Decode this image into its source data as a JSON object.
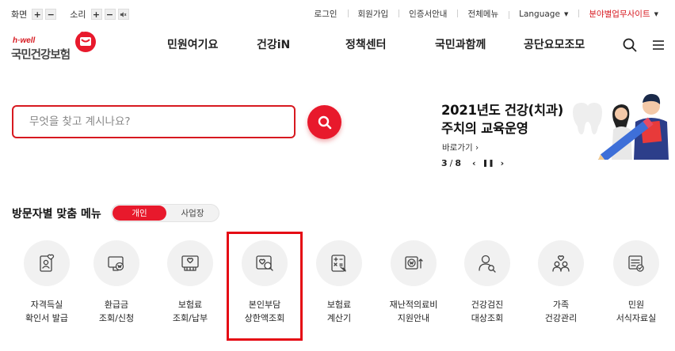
{
  "utility": {
    "screen_label": "화면",
    "sound_label": "소리",
    "plus": "+",
    "minus": "−",
    "links": [
      "로그인",
      "회원가입",
      "인증서안내",
      "전체메뉴",
      "Language",
      "분야별업무사이트"
    ]
  },
  "logo": {
    "tagline": "h·well",
    "name": "국민건강보험"
  },
  "nav": [
    "민원여기요",
    "건강iN",
    "정책센터",
    "국민과함께",
    "공단요모조모"
  ],
  "search": {
    "placeholder": "무엇을 찾고 계시나요?"
  },
  "banner": {
    "title_line1": "2021년도 건강(치과)",
    "title_line2": "주치의 교육운영",
    "more": "바로가기 ›",
    "current": "3",
    "separator": "/",
    "total": "8",
    "prev": "‹",
    "pause": "❚❚",
    "next": "›"
  },
  "visitor_menu": {
    "title": "방문자별 맞춤 메뉴",
    "tabs": [
      "개인",
      "사업장"
    ],
    "items": [
      {
        "line1": "자격득실",
        "line2": "확인서 발급",
        "icon": "certificate-icon"
      },
      {
        "line1": "환급금",
        "line2": "조회/신청",
        "icon": "refund-icon"
      },
      {
        "line1": "보험료",
        "line2": "조회/납부",
        "icon": "premium-payment-icon"
      },
      {
        "line1": "본인부담",
        "line2": "상한액조회",
        "icon": "copay-search-icon"
      },
      {
        "line1": "보험료",
        "line2": "계산기",
        "icon": "calculator-icon"
      },
      {
        "line1": "재난적의료비",
        "line2": "지원안내",
        "icon": "medical-support-icon"
      },
      {
        "line1": "건강검진",
        "line2": "대상조회",
        "icon": "checkup-icon"
      },
      {
        "line1": "가족",
        "line2": "건강관리",
        "icon": "family-icon"
      },
      {
        "line1": "민원",
        "line2": "서식자료실",
        "icon": "forms-icon"
      }
    ]
  },
  "colors": {
    "brand_red": "#e8192c",
    "highlight_red": "#e50914",
    "text": "#222222",
    "icon_bg": "#f1f1f1"
  }
}
